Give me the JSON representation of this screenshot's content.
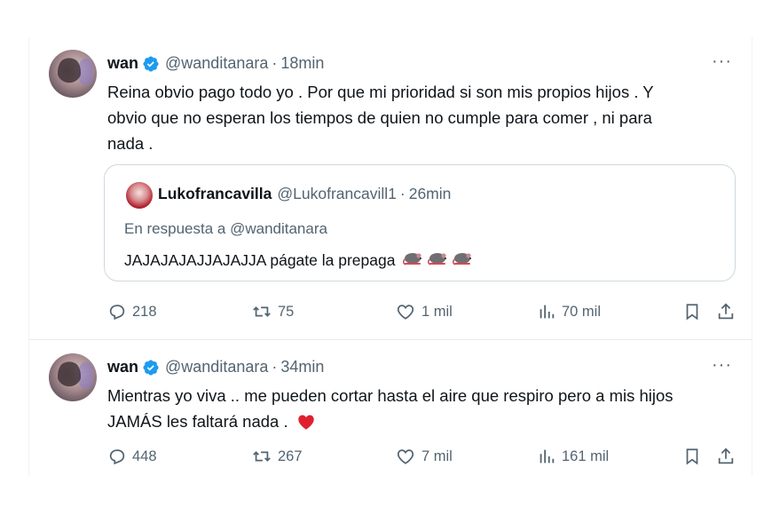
{
  "tweets": [
    {
      "name": "wan",
      "handle": "@wanditanara",
      "separator": "·",
      "time": "18min",
      "more": "···",
      "text_lines": [
        "Reina obvio pago todo yo . Por que mi prioridad si son mis propios hijos . Y",
        "obvio que no esperan los tiempos de quien no cumple para comer , ni para",
        "nada ."
      ],
      "quote": {
        "name": "Lukofrancavilla",
        "handle": "@Lukofrancavill1",
        "separator": "·",
        "time": "26min",
        "reply_to": "En respuesta a @wanditanara",
        "text": "JAJAJAJAJJAJAJJA págate la prepaga",
        "emoji_icons": [
          "rat-icon",
          "rat-icon",
          "rat-icon"
        ]
      },
      "stats": {
        "replies": "218",
        "retweets": "75",
        "likes": "1 mil",
        "views": "70 mil"
      }
    },
    {
      "name": "wan",
      "handle": "@wanditanara",
      "separator": "·",
      "time": "34min",
      "more": "···",
      "text_lines": [
        "Mientras yo viva .. me pueden cortar hasta el aire que respiro pero a mis hijos",
        "JAMÁS les faltará nada ."
      ],
      "trailing_icon": "red-heart-icon",
      "stats": {
        "replies": "448",
        "retweets": "267",
        "likes": "7 mil",
        "views": "161 mil"
      }
    }
  ],
  "icons": {
    "verified": "verified-badge-icon",
    "reply": "reply-icon",
    "retweet": "retweet-icon",
    "like": "like-icon",
    "views": "views-icon",
    "bookmark": "bookmark-icon",
    "share": "share-icon"
  },
  "colors": {
    "text": "#0f1419",
    "secondary": "#536471",
    "verified_blue": "#1d9bf0",
    "heart_red": "#e0202e",
    "border": "#cfd9de"
  }
}
